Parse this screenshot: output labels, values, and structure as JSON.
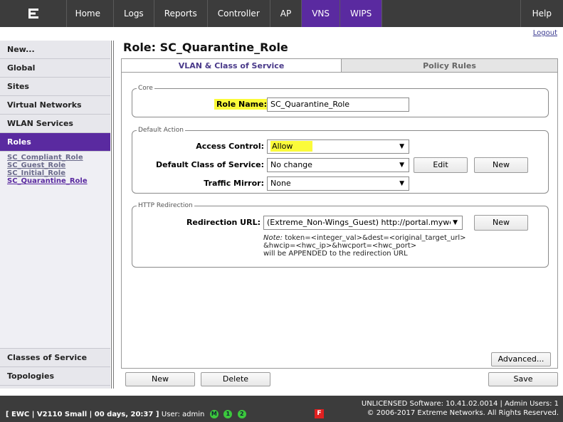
{
  "nav": {
    "items": [
      {
        "key": "home",
        "label": "Home"
      },
      {
        "key": "logs",
        "label": "Logs"
      },
      {
        "key": "reports",
        "label": "Reports"
      },
      {
        "key": "controller",
        "label": "Controller"
      },
      {
        "key": "ap",
        "label": "AP"
      },
      {
        "key": "vns",
        "label": "VNS"
      },
      {
        "key": "wips",
        "label": "WIPS"
      }
    ],
    "help": "Help",
    "logout": "Logout",
    "active": "VNS",
    "active_color": "#5a2aa0"
  },
  "sidebar": {
    "items": [
      "New...",
      "Global",
      "Sites",
      "Virtual Networks",
      "WLAN Services",
      "Roles"
    ],
    "active": "Roles",
    "roles": [
      "SC_Compliant_Role",
      "SC_Guest_Role",
      "SC_Initial_Role",
      "SC_Quarantine_Role"
    ],
    "current_role": "SC_Quarantine_Role",
    "bottom_items": [
      "Classes of Service",
      "Topologies"
    ]
  },
  "page": {
    "title": "Role: SC_Quarantine_Role",
    "tabs": [
      "VLAN & Class of Service",
      "Policy Rules"
    ],
    "active_tab": "VLAN & Class of Service"
  },
  "core": {
    "legend": "Core",
    "role_name_label": "Role Name:",
    "role_name_value": "SC_Quarantine_Role"
  },
  "default_action": {
    "legend": "Default Action",
    "access_control_label": "Access Control:",
    "access_control_value": "Allow",
    "cos_label": "Default Class of Service:",
    "cos_value": "No change",
    "edit_button": "Edit",
    "new_button": "New",
    "mirror_label": "Traffic Mirror:",
    "mirror_value": "None"
  },
  "http_redirection": {
    "legend": "HTTP Redirection",
    "url_label": "Redirection URL:",
    "url_value": "(Extreme_Non-Wings_Guest) http://portal.mywel",
    "new_button": "New",
    "note_prefix": "Note:",
    "note_line1": " token=<integer_val>&dest=<original_target_url>",
    "note_line2": "&hwcip=<hwc_ip>&hwcport=<hwc_port>",
    "note_line3": "will be APPENDED to the redirection URL"
  },
  "actions": {
    "advanced": "Advanced...",
    "new": "New",
    "delete": "Delete",
    "save": "Save"
  },
  "footer": {
    "status": "[ EWC | V2110 Small | 00 days, 20:37 ]",
    "user": "User: admin",
    "indicators": [
      "M",
      "1",
      "2"
    ],
    "flag": "F",
    "license": "UNLICENSED Software: 10.41.02.0014 | Admin Users: 1",
    "copyright": "© 2006-2017  Extreme Networks. All Rights Reserved."
  },
  "colors": {
    "highlight": "#fbfb3a",
    "accent": "#5a2aa0",
    "nav_bg": "#3c3c3c"
  }
}
